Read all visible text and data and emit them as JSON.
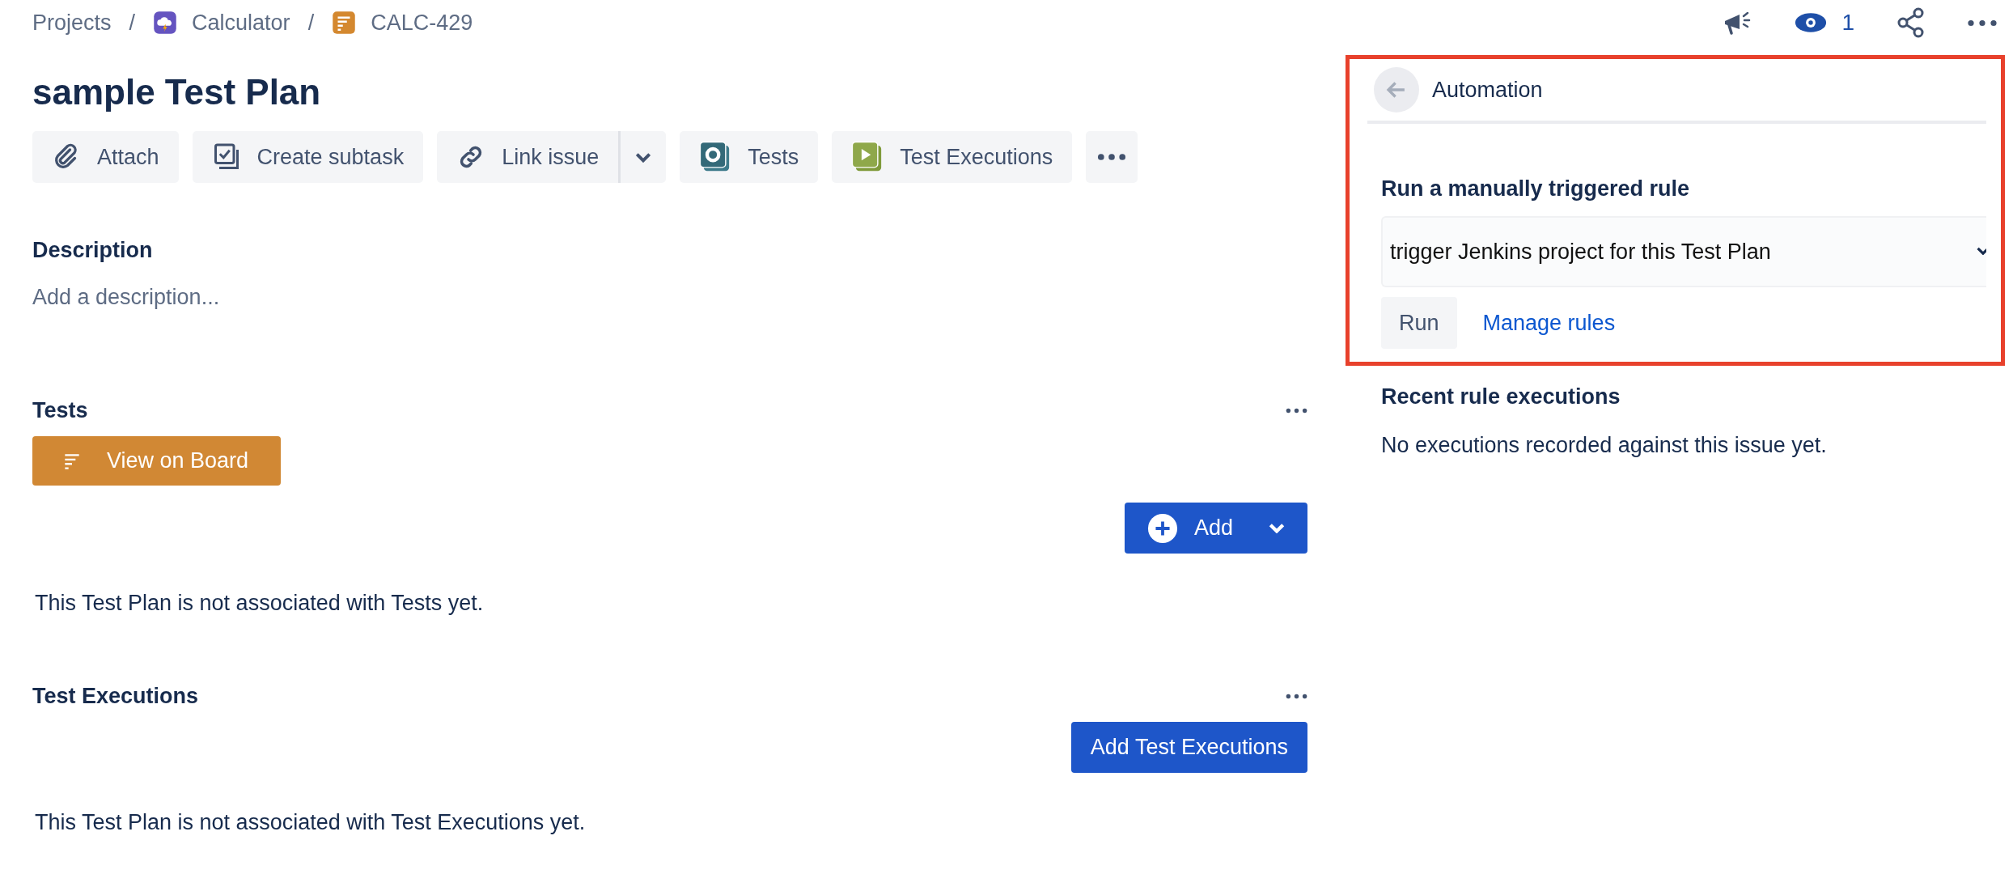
{
  "breadcrumbs": [
    {
      "label": "Projects",
      "kind": "text"
    },
    {
      "separator": "/",
      "label": "Calculator",
      "kind": "project"
    },
    {
      "separator": "/",
      "label": "CALC-429",
      "kind": "issue"
    }
  ],
  "header_actions": {
    "watchers": "1"
  },
  "issue": {
    "title": "sample Test Plan"
  },
  "toolbar": [
    {
      "label": "Attach",
      "kind": "attach"
    },
    {
      "label": "Create subtask",
      "kind": "subtask"
    },
    {
      "label": "Link issue",
      "kind": "link"
    },
    {
      "label": "Tests",
      "kind": "tests"
    },
    {
      "label": "Test Executions",
      "kind": "executions"
    }
  ],
  "description": {
    "heading": "Description",
    "placeholder": "Add a description..."
  },
  "sections": [
    {
      "heading": "Tests",
      "kind": "tests",
      "board_button": "View on Board",
      "add_button": "Add",
      "empty_text": "This Test Plan is not associated with Tests yet."
    },
    {
      "heading": "Test Executions",
      "kind": "executions",
      "add_button": "Add Test Executions",
      "empty_text": "This Test Plan is not associated with Test Executions yet."
    }
  ],
  "automation": {
    "title": "Automation",
    "highlighted": true,
    "rule_heading": "Run a manually triggered rule",
    "rule_select": {
      "value": "trigger Jenkins project for this Test Plan"
    },
    "run_button": "Run",
    "manage_link": "Manage rules",
    "recent_heading": "Recent rule executions",
    "recent_text": "No executions recorded against this issue yet."
  }
}
